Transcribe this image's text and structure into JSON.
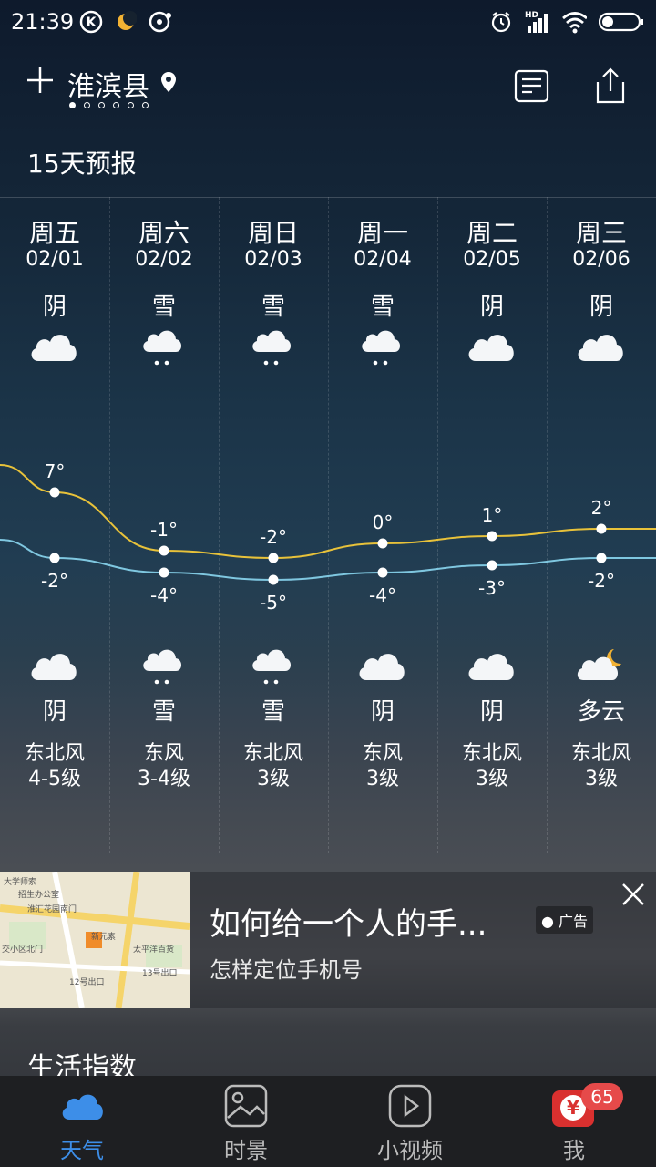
{
  "status_bar": {
    "time": "21:39",
    "network": "HD"
  },
  "header": {
    "city": "淮滨县",
    "page_count": 6,
    "active_page": 0
  },
  "forecast": {
    "title": "15天预报",
    "days": [
      {
        "weekday": "周五",
        "date": "02/01",
        "day_condition": "阴",
        "day_icon": "cloudy-icon",
        "high": "7°",
        "low": "-2°",
        "night_icon": "cloudy-icon",
        "night_condition": "阴",
        "wind_dir": "东北风",
        "wind_level": "4-5级"
      },
      {
        "weekday": "周六",
        "date": "02/02",
        "day_condition": "雪",
        "day_icon": "snow-icon",
        "high": "-1°",
        "low": "-4°",
        "night_icon": "snow-icon",
        "night_condition": "雪",
        "wind_dir": "东风",
        "wind_level": "3-4级"
      },
      {
        "weekday": "周日",
        "date": "02/03",
        "day_condition": "雪",
        "day_icon": "snow-icon",
        "high": "-2°",
        "low": "-5°",
        "night_icon": "snow-icon",
        "night_condition": "雪",
        "wind_dir": "东北风",
        "wind_level": "3级"
      },
      {
        "weekday": "周一",
        "date": "02/04",
        "day_condition": "雪",
        "day_icon": "snow-icon",
        "high": "0°",
        "low": "-4°",
        "night_icon": "cloudy-icon",
        "night_condition": "阴",
        "wind_dir": "东风",
        "wind_level": "3级"
      },
      {
        "weekday": "周二",
        "date": "02/05",
        "day_condition": "阴",
        "day_icon": "cloudy-icon",
        "high": "1°",
        "low": "-3°",
        "night_icon": "cloudy-icon",
        "night_condition": "阴",
        "wind_dir": "东北风",
        "wind_level": "3级"
      },
      {
        "weekday": "周三",
        "date": "02/06",
        "day_condition": "阴",
        "day_icon": "cloudy-icon",
        "high": "2°",
        "low": "-2°",
        "night_icon": "partly-cloudy-night-icon",
        "night_condition": "多云",
        "wind_dir": "东北风",
        "wind_level": "3级"
      }
    ],
    "high_values": [
      7,
      -1,
      -2,
      0,
      1,
      2
    ],
    "low_values": [
      -2,
      -4,
      -5,
      -4,
      -3,
      -2
    ]
  },
  "ad": {
    "title": "如何给一个人的手...",
    "subtitle": "怎样定位手机号",
    "badge": "广告",
    "map_labels": [
      "大学师索",
      "招生办公室",
      "淮汇花园南门",
      "新元素",
      "太平洋百货",
      "交小区北门",
      "13号出口",
      "12号出口"
    ]
  },
  "life_index": {
    "title": "生活指数"
  },
  "nav": {
    "items": [
      {
        "label": "天气",
        "icon": "cloud-icon",
        "active": true
      },
      {
        "label": "时景",
        "icon": "image-icon",
        "active": false
      },
      {
        "label": "小视频",
        "icon": "play-icon",
        "active": false
      },
      {
        "label": "我",
        "icon": "yuan-wallet-icon",
        "active": false,
        "badge": "65"
      }
    ]
  },
  "colors": {
    "high_line": "#e8c23a",
    "low_line": "#7fc7e0",
    "nav_active": "#3d8ee8",
    "badge": "#e64a4a"
  }
}
